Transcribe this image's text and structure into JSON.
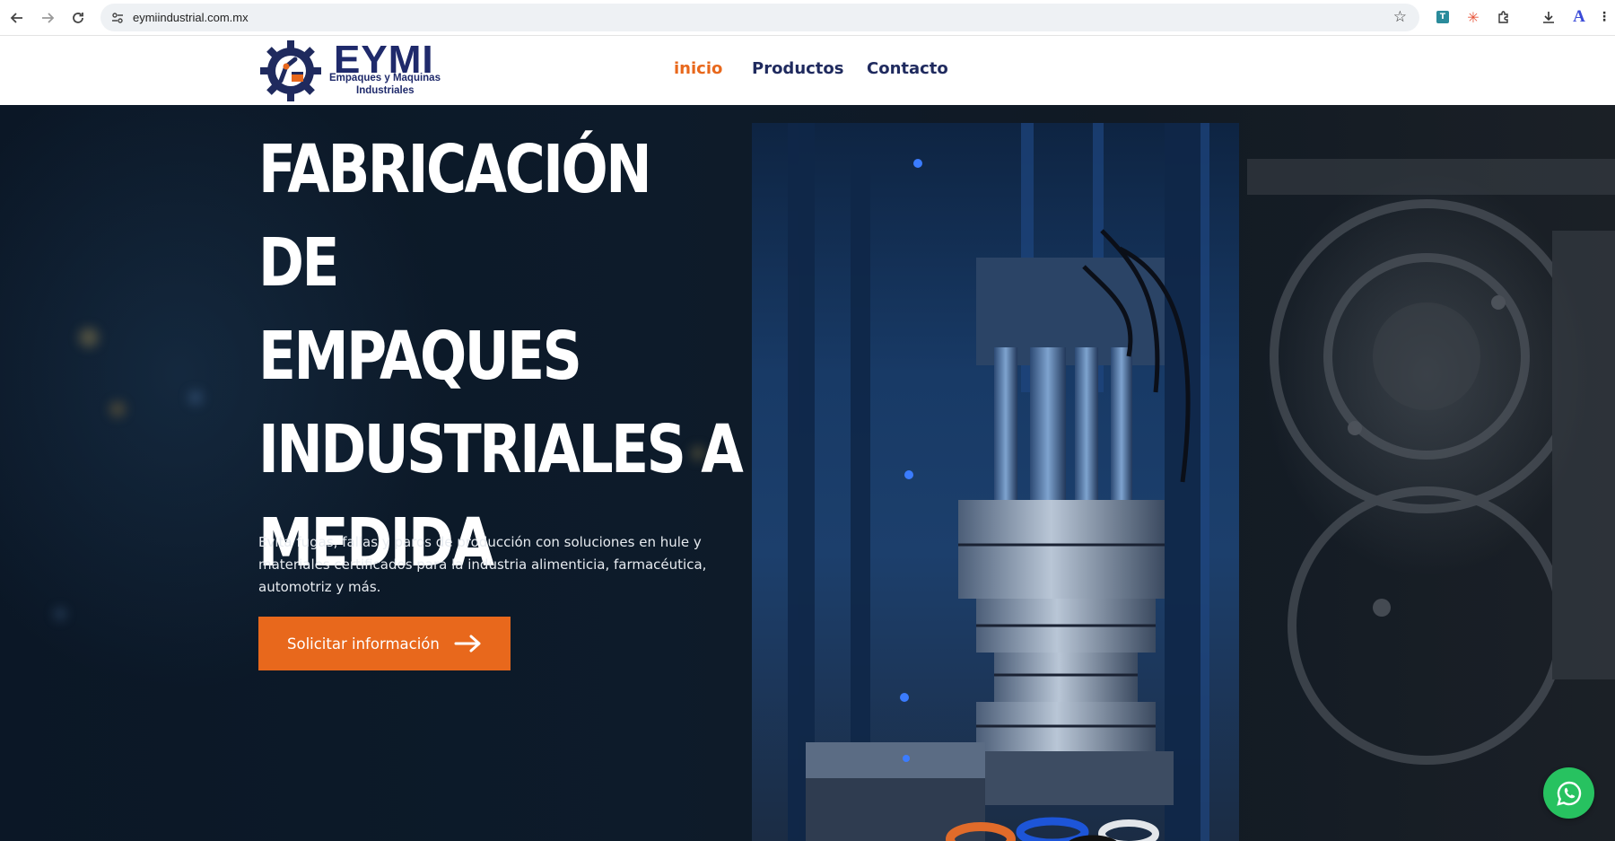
{
  "browser": {
    "url": "eymiindustrial.com.mx",
    "icons": [
      "back-icon",
      "forward-icon",
      "reload-icon",
      "site-info-icon",
      "bookmark-star-icon",
      "extension-icon",
      "downloads-icon",
      "menu-icon"
    ]
  },
  "header": {
    "logo": {
      "title": "EYMI",
      "subtitle_line1": "Empaques y Maquinas",
      "subtitle_line2": "Industriales"
    },
    "menu": [
      {
        "label": "inicio",
        "active": true
      },
      {
        "label": "Productos",
        "active": false
      },
      {
        "label": "Contacto",
        "active": false
      }
    ]
  },
  "hero": {
    "title_lines": [
      "FABRICACIÓN DE",
      "EMPAQUES",
      "INDUSTRIALES A",
      "MEDIDA"
    ],
    "description": "Evita fugas, fallas y paros de producción con soluciones en hule y materiales certificados para la industria alimenticia, farmacéutica, automotriz y más.",
    "cta_label": "Solicitar información"
  },
  "colors": {
    "accent": "#e8681c",
    "brand_navy": "#1f2a5e",
    "whatsapp": "#27c260"
  }
}
